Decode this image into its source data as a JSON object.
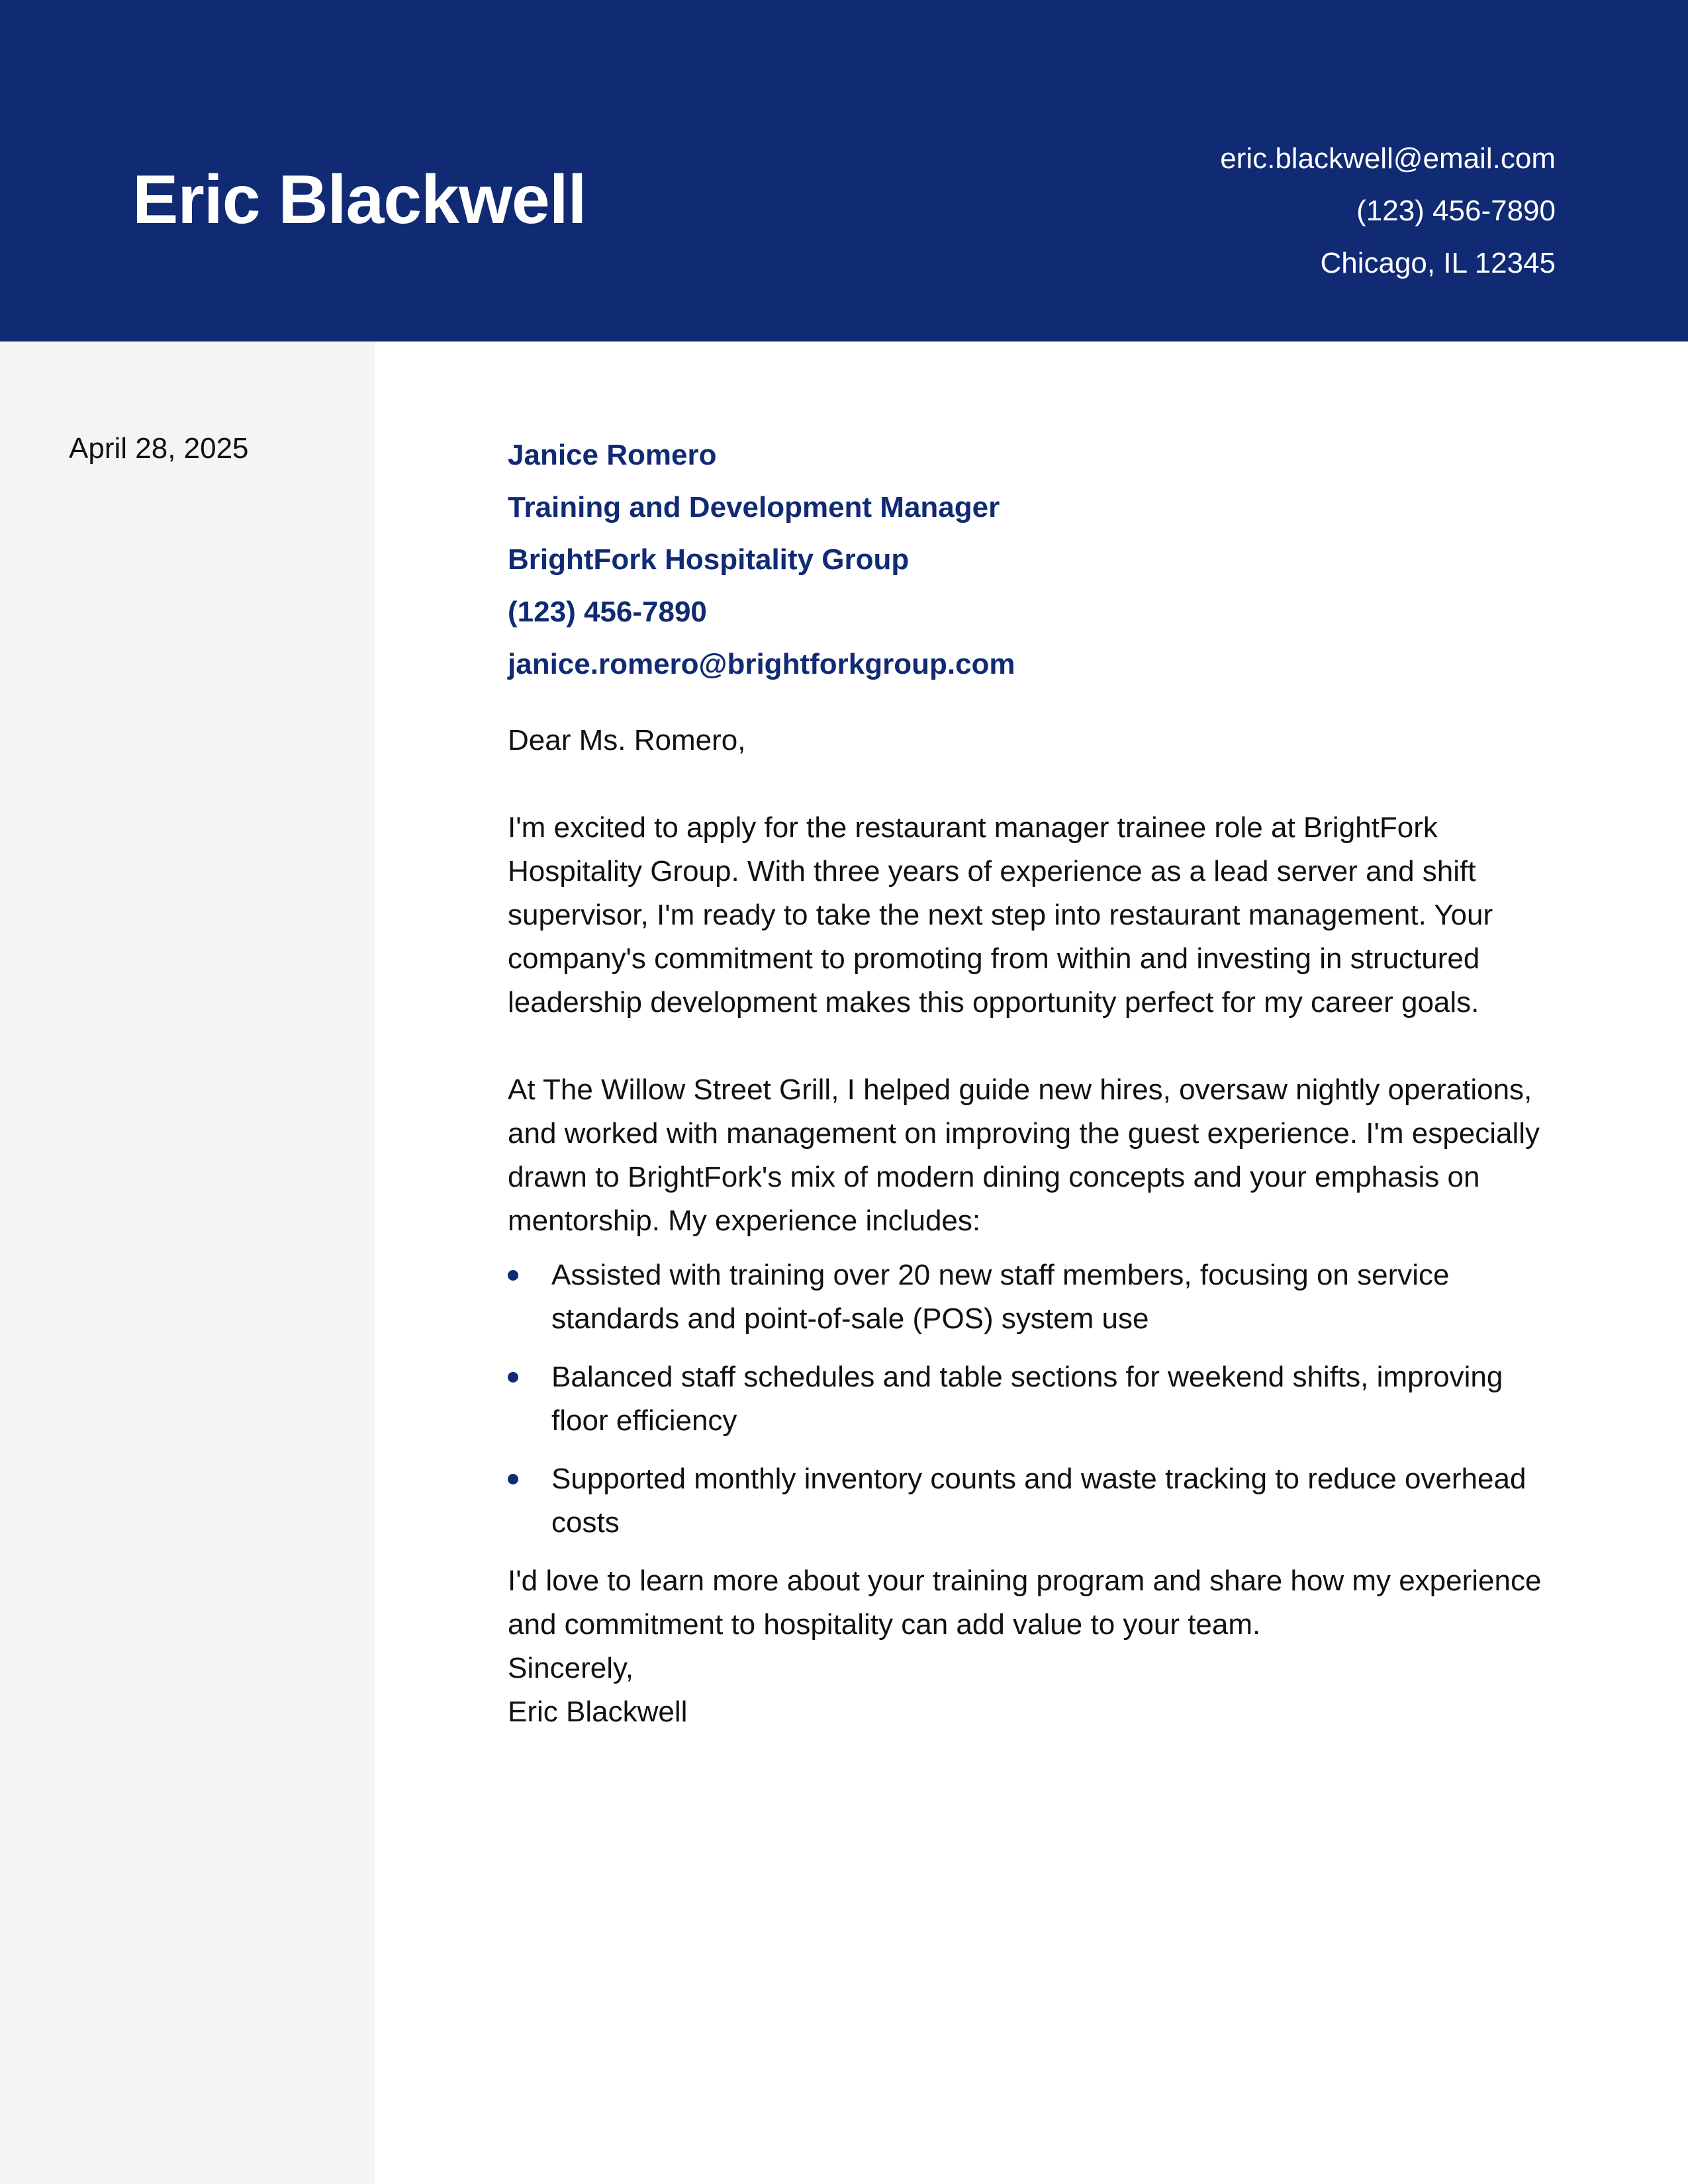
{
  "header": {
    "name": "Eric Blackwell",
    "email": "eric.blackwell@email.com",
    "phone": "(123) 456-7890",
    "location": "Chicago, IL 12345"
  },
  "sidebar": {
    "date": "April 28, 2025"
  },
  "recipient": {
    "name": "Janice Romero",
    "title": "Training and Development Manager",
    "company": "BrightFork Hospitality Group",
    "phone": "(123) 456-7890",
    "email": "janice.romero@brightforkgroup.com"
  },
  "letter": {
    "salutation": "Dear Ms. Romero,",
    "paragraphs": [
      "I'm excited to apply for the restaurant manager trainee role at BrightFork Hospitality Group. With three years of experience as a lead server and shift supervisor, I'm ready to take the next step into restaurant management. Your company's commitment to promoting from within and investing in structured leadership development makes this opportunity perfect for my career goals.",
      "At The Willow Street Grill, I helped guide new hires, oversaw nightly operations, and worked with management on improving the guest experience. I'm especially drawn to BrightFork's mix of modern dining concepts and your emphasis on mentorship. My experience includes:"
    ],
    "bullets": [
      "Assisted with training over 20 new staff members, focusing on service standards and point-of-sale (POS) system use",
      "Balanced staff schedules and table sections for weekend shifts, improving floor efficiency",
      "Supported monthly inventory counts and waste tracking to reduce overhead costs"
    ],
    "closing_paragraph": "I'd love to learn more about your training program and share how my experience and commitment to hospitality can add value to your team.",
    "sign_off": "Sincerely,",
    "signature": "Eric Blackwell"
  },
  "colors": {
    "brand_navy": "#102a73",
    "sidebar_gray": "#f4f4f4"
  }
}
